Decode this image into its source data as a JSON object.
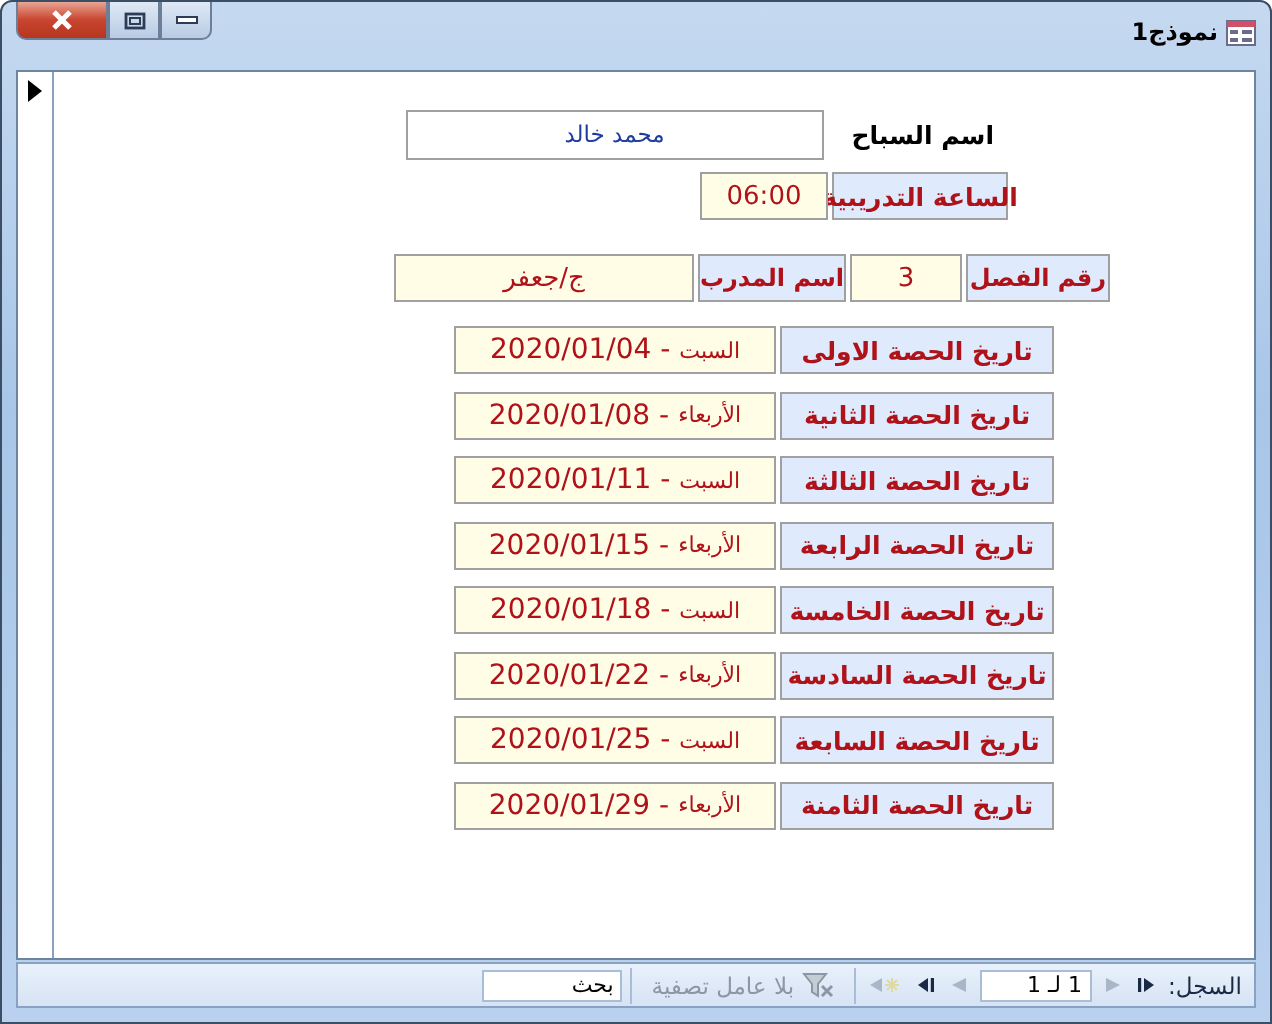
{
  "window": {
    "title": "نموذج1"
  },
  "swimmer": {
    "label": "اسم السباح",
    "value": "محمد خالد"
  },
  "training_time": {
    "label": "الساعة التدريبية",
    "value": "06:00"
  },
  "class_number": {
    "label": "رقم الفصل",
    "value": "3"
  },
  "coach": {
    "label": "اسم المدرب",
    "value": "ج/جعفر"
  },
  "sessions": [
    {
      "label": "تاريخ الحصة الاولى",
      "day": "السبت",
      "separator": "-",
      "date": "2020/01/04"
    },
    {
      "label": "تاريخ الحصة الثانية",
      "day": "الأربعاء",
      "separator": "-",
      "date": "2020/01/08"
    },
    {
      "label": "تاريخ الحصة الثالثة",
      "day": "السبت",
      "separator": "-",
      "date": "2020/01/11"
    },
    {
      "label": "تاريخ الحصة الرابعة",
      "day": "الأربعاء",
      "separator": "-",
      "date": "2020/01/15"
    },
    {
      "label": "تاريخ الحصة الخامسة",
      "day": "السبت",
      "separator": "-",
      "date": "2020/01/18"
    },
    {
      "label": "تاريخ الحصة السادسة",
      "day": "الأربعاء",
      "separator": "-",
      "date": "2020/01/22"
    },
    {
      "label": "تاريخ الحصة السابعة",
      "day": "السبت",
      "separator": "-",
      "date": "2020/01/25"
    },
    {
      "label": "تاريخ الحصة الثامنة",
      "day": "الأربعاء",
      "separator": "-",
      "date": "2020/01/29"
    }
  ],
  "navigation": {
    "label": "السجل:",
    "position": "1 لـ 1",
    "filter": "بلا عامل تصفية",
    "search_placeholder": "بحث"
  }
}
